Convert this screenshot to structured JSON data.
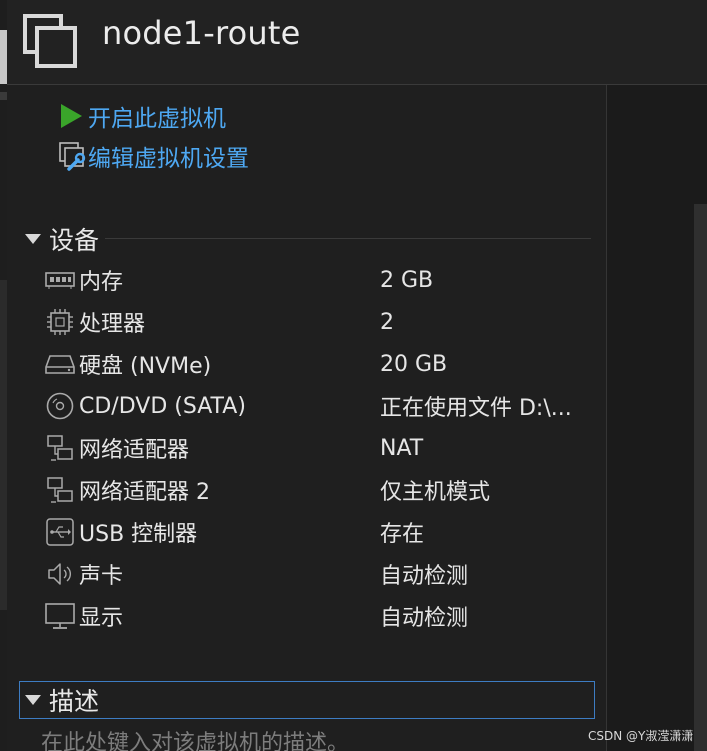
{
  "window": {
    "title": "node1-route"
  },
  "actions": [
    {
      "label": "开启此虚拟机",
      "icon": "play-icon"
    },
    {
      "label": "编辑虚拟机设置",
      "icon": "edit-settings-icon"
    }
  ],
  "devices_section": {
    "title": "设备",
    "rows": [
      {
        "name": "内存",
        "value": "2 GB",
        "icon": "memory-icon"
      },
      {
        "name": "处理器",
        "value": "2",
        "icon": "processor-icon"
      },
      {
        "name": "硬盘 (NVMe)",
        "value": "20 GB",
        "icon": "hard-disk-icon"
      },
      {
        "name": "CD/DVD (SATA)",
        "value": "正在使用文件 D:\\...",
        "icon": "cd-dvd-icon"
      },
      {
        "name": "网络适配器",
        "value": "NAT",
        "icon": "network-adapter-icon"
      },
      {
        "name": "网络适配器 2",
        "value": "仅主机模式",
        "icon": "network-adapter-icon"
      },
      {
        "name": "USB 控制器",
        "value": "存在",
        "icon": "usb-icon"
      },
      {
        "name": "声卡",
        "value": "自动检测",
        "icon": "sound-card-icon"
      },
      {
        "name": "显示",
        "value": "自动检测",
        "icon": "display-icon"
      }
    ]
  },
  "description_section": {
    "title": "描述",
    "placeholder": "在此处键入对该虚拟机的描述。"
  },
  "watermark": "CSDN @Y淑滢潇潇",
  "colors": {
    "background": "#1f1f1f",
    "link": "#4ea8f2",
    "play_green": "#3aa52a",
    "focus_border": "#3d7cc2"
  }
}
